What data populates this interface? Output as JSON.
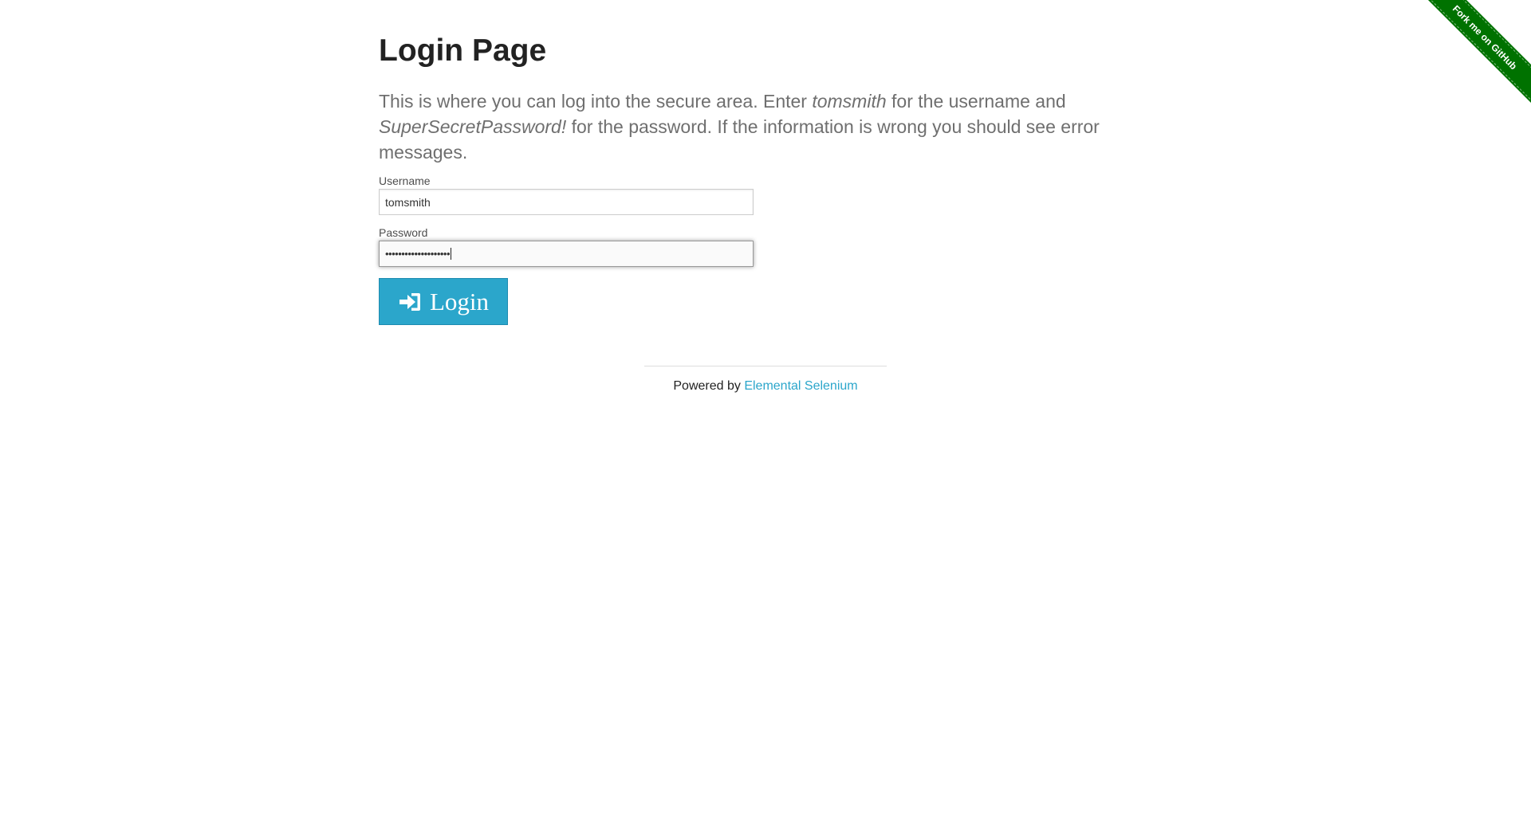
{
  "page": {
    "title": "Login Page",
    "description": {
      "part1": "This is where you can log into the secure area. Enter ",
      "username_hint": "tomsmith",
      "part2": " for the username and ",
      "password_hint": "SuperSecretPassword!",
      "part3": " for the password. If the information is wrong you should see error messages."
    }
  },
  "form": {
    "username_label": "Username",
    "username_value": "tomsmith",
    "password_label": "Password",
    "password_masked": "••••••••••••••••••••",
    "login_label": "Login",
    "login_icon": "sign-in-icon"
  },
  "footer": {
    "powered_by": "Powered by ",
    "link_text": "Elemental Selenium"
  },
  "ribbon": {
    "label": "Fork me on GitHub",
    "color": "#007200"
  },
  "colors": {
    "accent": "#2ba6cb",
    "text": "#222222",
    "muted": "#6f6f6f"
  }
}
